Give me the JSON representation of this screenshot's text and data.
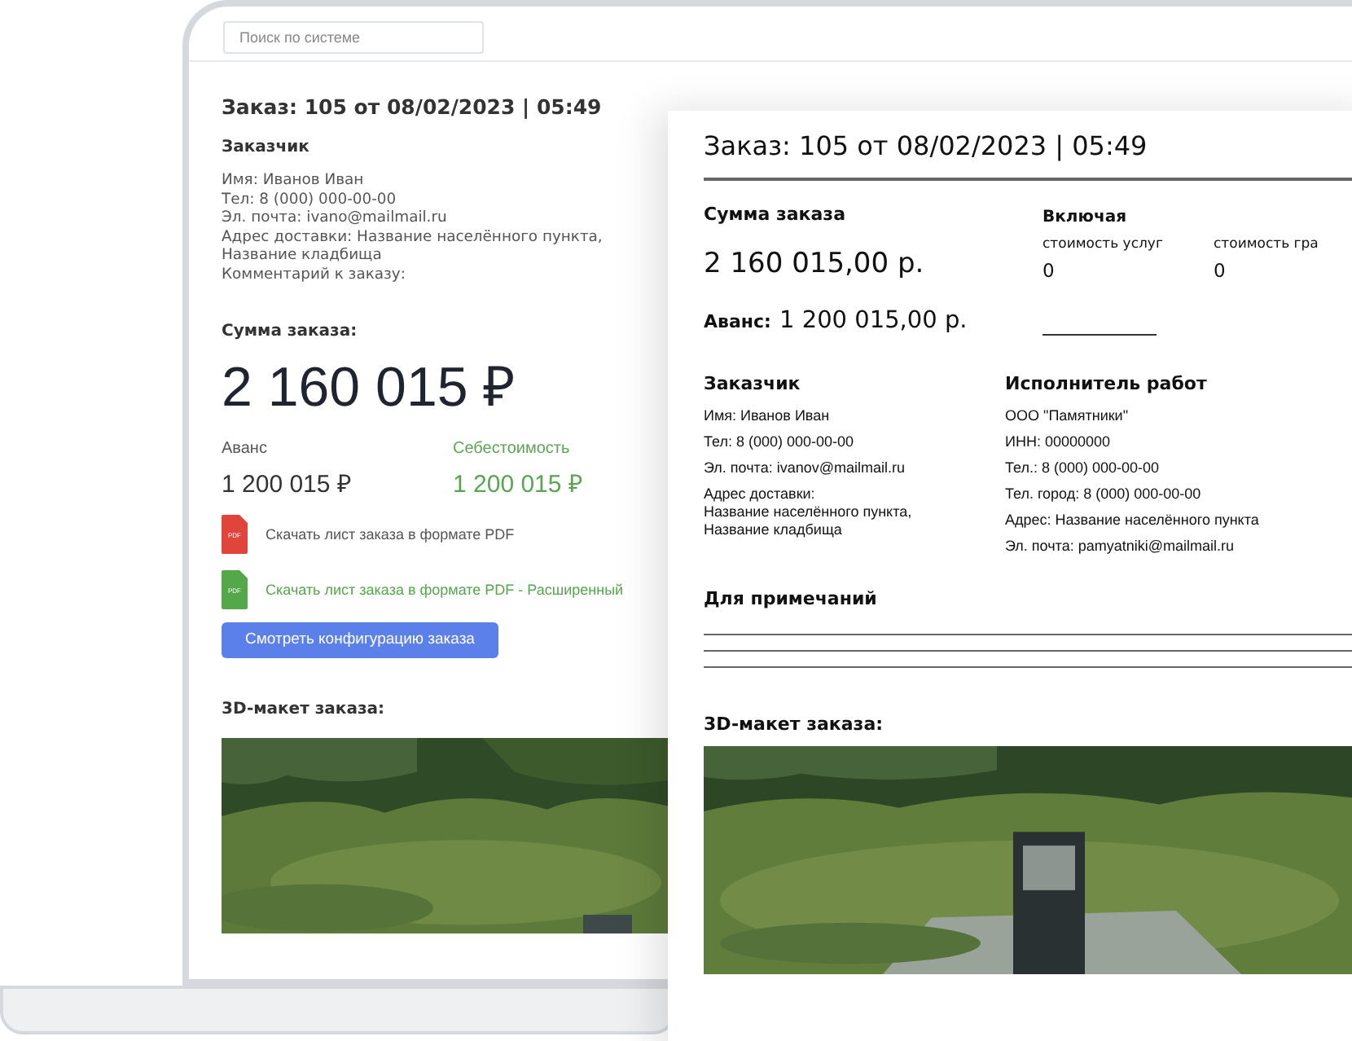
{
  "app": {
    "search": {
      "placeholder": "Поиск по системе"
    },
    "title": "Заказ: 105 от 08/02/2023 | 05:49",
    "customer": {
      "heading": "Заказчик",
      "lines": [
        "Имя: Иванов Иван",
        "Тел: 8 (000) 000-00-00",
        "Эл. почта: ivano@mailmail.ru",
        "Адрес доставки: Название населённого пункта, Название кладбища",
        "Комментарий к заказу:"
      ]
    },
    "total": {
      "label": "Сумма заказа:",
      "value": "2 160 015 ₽"
    },
    "figures": [
      {
        "kind": "plain",
        "label": "Аванс",
        "value": "1 200 015 ₽"
      },
      {
        "kind": "accent",
        "label": "Себестоимость",
        "value": "1 200 015 ₽"
      }
    ],
    "downloads": [
      {
        "color": "#e0443a",
        "icon": "PDF",
        "label": "Скачать лист заказа в формате PDF"
      },
      {
        "color": "#55a84a",
        "icon": "PDF",
        "label": "Скачать лист заказа в формате PDF - Расширенный"
      }
    ],
    "button": "Смотреть конфигурацию заказа",
    "model_heading": "3D-макет заказа:"
  },
  "document": {
    "title": "Заказ: 105 от 08/02/2023 | 05:49",
    "total_label": "Сумма заказа",
    "total_value": "2 160 015,00 р.",
    "advance_label": "Аванс:",
    "advance_value": "1 200 015,00 р.",
    "including": {
      "heading": "Включая",
      "items": [
        {
          "label": "стоимость услуг",
          "value": "0"
        },
        {
          "label": "стоимость гра",
          "value": "0"
        }
      ]
    },
    "customer": {
      "heading": "Заказчик",
      "lines": [
        "Имя: Иванов Иван",
        "Тел: 8 (000) 000-00-00",
        "Эл. почта: ivanov@mailmail.ru",
        "Адрес доставки:\nНазвание населённого пункта,\nНазвание кладбища"
      ]
    },
    "contractor": {
      "heading": "Исполнитель работ",
      "lines": [
        "ООО \"Памятники\"",
        "ИНН: 00000000",
        "Тел.: 8 (000) 000-00-00",
        "Тел. город: 8 (000) 000-00-00",
        "Адрес: Название населённого пункта",
        "Эл. почта: pamyatniki@mailmail.ru"
      ]
    },
    "notes_heading": "Для примечаний",
    "model_heading": "3D-макет заказа:"
  }
}
